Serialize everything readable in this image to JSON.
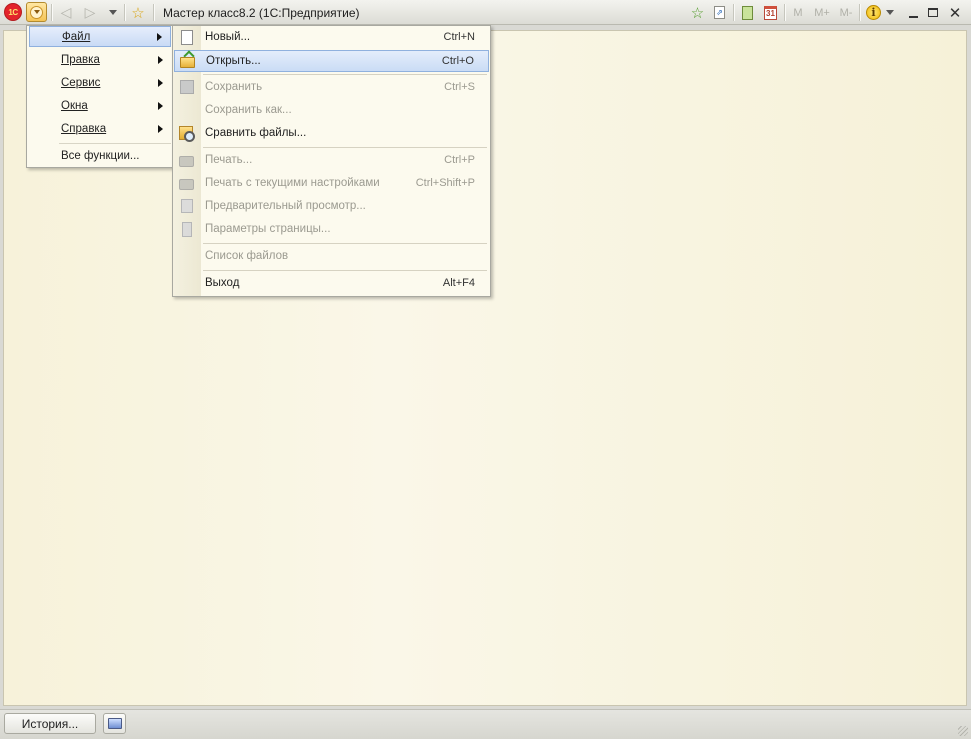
{
  "window": {
    "title": "Мастер класс8.2  (1С:Предприятие)",
    "logo_text": "1С",
    "icons": [
      "1c-logo-icon",
      "main-menu-icon",
      "back-arrow-icon",
      "forward-arrow-icon",
      "history-dropdown-icon",
      "favorites-star-icon",
      "add-favorite-icon",
      "link-icon",
      "calculator-icon",
      "calendar-icon",
      "info-icon",
      "minimize-icon",
      "maximize-icon",
      "close-icon"
    ],
    "calendar_day": "31",
    "memory_buttons": [
      "M",
      "M+",
      "M-"
    ],
    "info_label": "i"
  },
  "main_menu": {
    "items": [
      {
        "label": "Файл",
        "active": true,
        "has_submenu": true
      },
      {
        "label": "Правка",
        "has_submenu": true
      },
      {
        "label": "Сервис",
        "has_submenu": true
      },
      {
        "label": "Окна",
        "has_submenu": true
      },
      {
        "label": "Справка",
        "has_submenu": true
      },
      {
        "label": "Все функции...",
        "has_submenu": false
      }
    ]
  },
  "file_menu": {
    "items": [
      {
        "label": "Новый...",
        "shortcut": "Ctrl+N",
        "icon": "new-document-icon",
        "enabled": true
      },
      {
        "label": "Открыть...",
        "shortcut": "Ctrl+O",
        "icon": "open-folder-icon",
        "enabled": true,
        "active": true
      },
      {
        "label": "Сохранить",
        "shortcut": "Ctrl+S",
        "icon": "save-disk-icon",
        "enabled": false
      },
      {
        "label": "Сохранить как...",
        "shortcut": "",
        "enabled": false
      },
      {
        "label": "Сравнить файлы...",
        "shortcut": "",
        "icon": "compare-files-icon",
        "enabled": true
      },
      {
        "label": "Печать...",
        "shortcut": "Ctrl+P",
        "icon": "printer-icon",
        "enabled": false
      },
      {
        "label": "Печать с текущими настройками",
        "shortcut": "Ctrl+Shift+P",
        "icon": "printer-settings-icon",
        "enabled": false
      },
      {
        "label": "Предварительный просмотр...",
        "shortcut": "",
        "icon": "print-preview-icon",
        "enabled": false
      },
      {
        "label": "Параметры страницы...",
        "shortcut": "",
        "icon": "page-setup-icon",
        "enabled": false
      },
      {
        "label": "Список файлов",
        "shortcut": "",
        "enabled": false
      },
      {
        "label": "Выход",
        "shortcut": "Alt+F4",
        "enabled": true
      }
    ]
  },
  "statusbar": {
    "history_label": "История..."
  },
  "colors": {
    "workspace_bg": "#faf6e4",
    "menu_bg": "#fcfaee",
    "highlight": "#cadcf5",
    "disabled_text": "#9b9a90"
  }
}
